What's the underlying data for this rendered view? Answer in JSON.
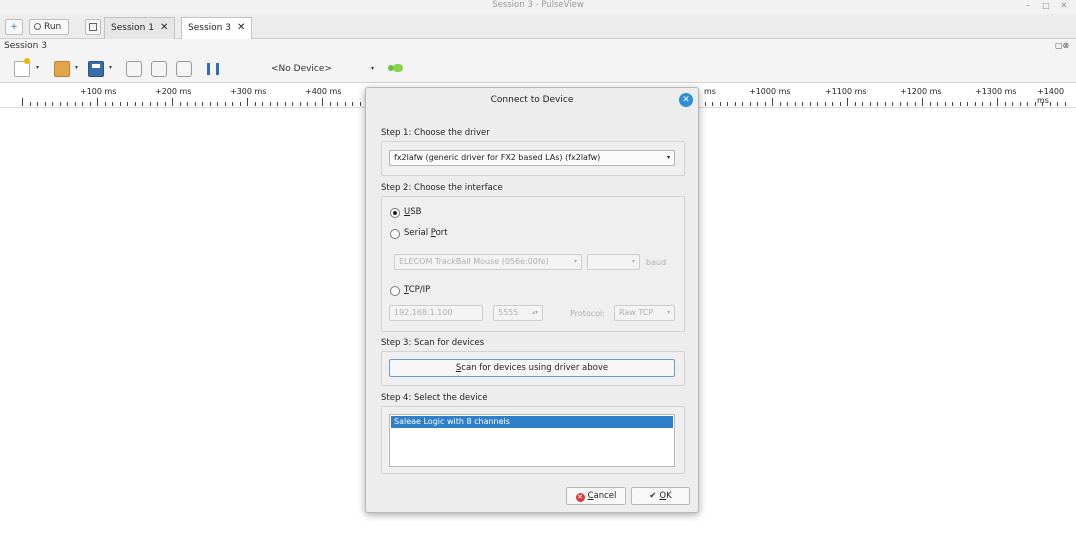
{
  "window": {
    "title": "Session 3 - PulseView",
    "min_label": "–",
    "max_label": "□",
    "close_label": "✕"
  },
  "tabbar": {
    "new_label": "+",
    "run_label": "Run",
    "tabs": [
      {
        "label": "Session 1",
        "close": "✕"
      },
      {
        "label": "Session 3",
        "close": "✕"
      }
    ]
  },
  "session_bar": {
    "label": "Session 3",
    "controls": "▢⊗"
  },
  "toolbar": {
    "device_select": {
      "value": "<No Device>",
      "arrow": "▾"
    },
    "dropdown_arrow": "▾",
    "icons": [
      "new-file-icon",
      "open-icon",
      "save-icon",
      "triggers-icon",
      "decoders-icon",
      "math-icon",
      "add-signal-icon",
      "cursor-icon",
      "device-config-icon"
    ]
  },
  "ruler": {
    "labels": [
      "+100 ms",
      "+200 ms",
      "+300 ms",
      "+400 ms",
      "ms",
      "+1000 ms",
      "+1100 ms",
      "+1200 ms",
      "+1300 ms",
      "+1400 ms"
    ]
  },
  "dialog": {
    "title": "Connect to Device",
    "close_label": "✕",
    "step1": {
      "label": "Step 1: Choose the driver",
      "driver": "fx2lafw (generic driver for FX2 based LAs) (fx2lafw)",
      "arrow": "▾"
    },
    "step2": {
      "label": "Step 2: Choose the interface",
      "usb_first": "U",
      "usb_rest": "SB",
      "serial_prefix": "Serial ",
      "serial_ul": "P",
      "serial_rest": "ort",
      "serial_device": "ELECOM TrackBall Mouse (056e:00fe)",
      "baud_label": "baud",
      "tcp_first": "T",
      "tcp_rest": "CP/IP",
      "host": "192.168.1.100",
      "port": "5555",
      "protocol_label": "Protocol:",
      "protocol": "Raw TCP",
      "arrow": "▾",
      "spin": "▴▾"
    },
    "step3": {
      "label": "Step 3: Scan for devices",
      "scan_first": "S",
      "scan_rest": "can for devices using driver above"
    },
    "step4": {
      "label": "Step 4: Select the device",
      "devices": [
        "Saleae Logic with 8 channels"
      ]
    },
    "cancel_icon": "✕",
    "cancel_first": "C",
    "cancel_rest": "ancel",
    "ok_icon": "✔",
    "ok_first": "O",
    "ok_rest": "K"
  },
  "colors": {
    "accent": "#2f7fc9",
    "close_blue": "#2d8fd6",
    "cancel_red": "#d93a3a"
  }
}
